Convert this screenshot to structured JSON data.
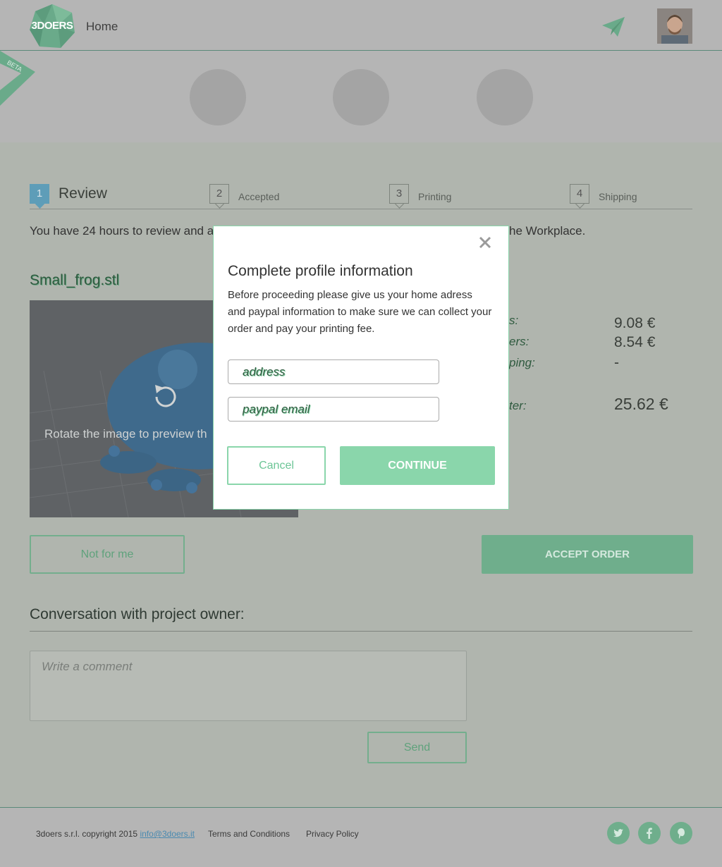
{
  "header": {
    "logo_text": "3DOERS",
    "home_label": "Home",
    "send_icon": "paper-plane-icon",
    "beta_label": "BETA"
  },
  "steps": [
    {
      "num": "1",
      "label": "Review",
      "active": true
    },
    {
      "num": "2",
      "label": "Accepted",
      "active": false
    },
    {
      "num": "3",
      "label": "Printing",
      "active": false
    },
    {
      "num": "4",
      "label": "Shipping",
      "active": false
    }
  ],
  "notice": {
    "left": "You have 24 hours to review and a",
    "right": "he Workplace."
  },
  "file": {
    "title": "Small_frog.stl",
    "rotate_hint": "Rotate the image to preview th"
  },
  "prices": [
    {
      "label": "s:",
      "value": "9.08 €"
    },
    {
      "label": "ers:",
      "value": "8.54 €"
    },
    {
      "label": "ping:",
      "value": "-"
    },
    {
      "label": "ter:",
      "value": "25.62 €"
    }
  ],
  "actions": {
    "decline_label": "Not for me",
    "accept_label": "ACCEPT ORDER"
  },
  "conversation": {
    "title": "Conversation with project owner:",
    "placeholder": "Write a comment",
    "send_label": "Send"
  },
  "footer": {
    "copyright": "3doers s.r.l. copyright 2015",
    "email": "info@3doers.it",
    "terms": "Terms and Conditions",
    "privacy": "Privacy Policy"
  },
  "modal": {
    "title": "Complete profile information",
    "text": "Before proceeding please give us your home adress and paypal information to make sure we can collect your order and pay your printing fee.",
    "address_placeholder": "address",
    "paypal_placeholder": "paypal email",
    "cancel_label": "Cancel",
    "continue_label": "CONTINUE"
  },
  "colors": {
    "accent": "#8ad6ab",
    "overlay": "#b0b5ae",
    "step_active": "#5e9db8"
  }
}
